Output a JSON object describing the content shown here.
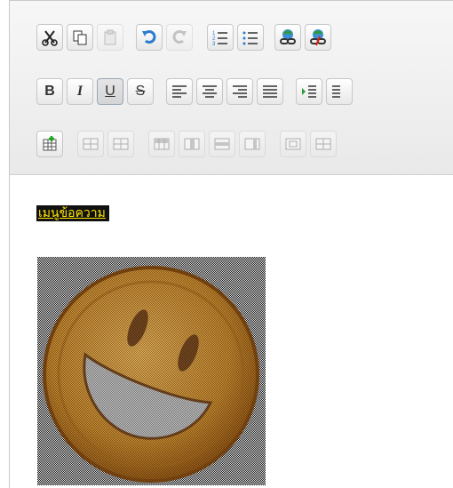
{
  "toolbar": {
    "rows": [
      [
        "cut",
        "copy",
        "paste",
        "undo",
        "redo",
        "ordered-list",
        "unordered-list",
        "link",
        "unlink"
      ],
      [
        "bold",
        "italic",
        "underline",
        "strikethrough",
        "align-left",
        "align-center",
        "align-right",
        "justify",
        "indent",
        "outdent"
      ],
      [
        "table",
        "merge-cells",
        "split-cells",
        "insert-row-before",
        "insert-row-after",
        "delete-row",
        "delete-col",
        "cell-props",
        "row-props"
      ]
    ],
    "labels": {
      "bold": "B",
      "italic": "I",
      "underline": "U",
      "strike": "S"
    }
  },
  "content": {
    "highlight_text": "เมนูข้อความ",
    "highlight_bg": "#111111",
    "highlight_fg": "#ffe500",
    "image": "laughing-smiley-icon"
  }
}
